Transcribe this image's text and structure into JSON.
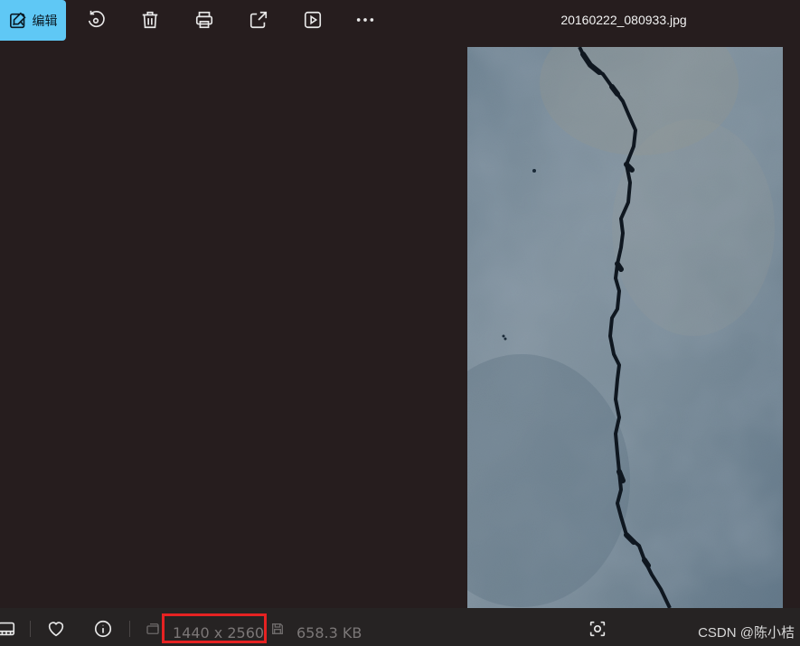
{
  "toolbar": {
    "edit_label": "编辑",
    "accent_color": "#5fc8f5",
    "icons": [
      "edit-image-icon",
      "rotate-icon",
      "delete-icon",
      "print-icon",
      "share-icon",
      "slideshow-icon",
      "more-icon"
    ]
  },
  "file": {
    "name": "20160222_080933.jpg"
  },
  "photo": {
    "description_icon": "concrete-crack-photo"
  },
  "statusbar": {
    "dimensions": "1440 x 2560",
    "file_size": "658.3 KB",
    "highlight_color": "#e52222"
  },
  "watermark": "CSDN @陈小桔"
}
